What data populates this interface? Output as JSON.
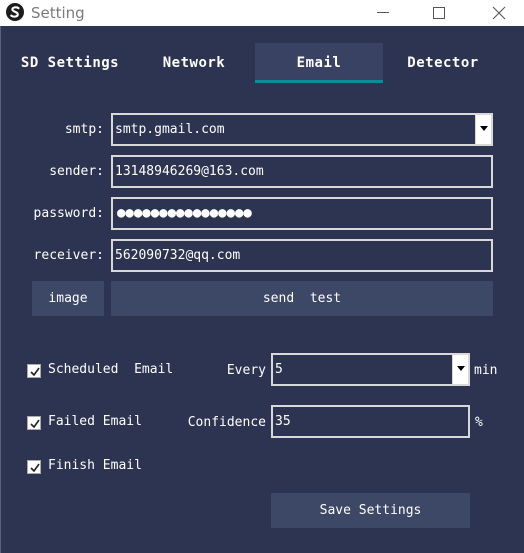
{
  "window": {
    "title": "Setting",
    "app_icon": "s-logo-icon",
    "controls": [
      "minimize-icon",
      "maximize-icon",
      "close-icon"
    ]
  },
  "tabs": [
    {
      "label": "SD Settings",
      "active": false
    },
    {
      "label": "Network",
      "active": false
    },
    {
      "label": "Email",
      "active": true
    },
    {
      "label": "Detector",
      "active": false
    }
  ],
  "email_form": {
    "smtp": {
      "label": "smtp:",
      "value": "smtp.gmail.com"
    },
    "sender": {
      "label": "sender:",
      "value": "13148946269@163.com"
    },
    "password": {
      "label": "password:",
      "value": "●●●●●●●●●●●●●●●●"
    },
    "receiver": {
      "label": "receiver:",
      "value": "562090732@qq.com"
    },
    "image_button": "image",
    "send_test_button": "send  test"
  },
  "options": {
    "scheduled": {
      "label": "Scheduled  Email",
      "checked": true
    },
    "every_label": "Every",
    "every_value": "5",
    "every_unit": "min",
    "failed": {
      "label": "Failed Email",
      "checked": true
    },
    "confidence_label": "Confidence",
    "confidence_value": "35",
    "confidence_unit": "%",
    "finish": {
      "label": "Finish Email",
      "checked": true
    }
  },
  "save_button": "Save Settings",
  "colors": {
    "background": "#2d3451",
    "tab_active": "#3a4263",
    "tab_underline": "#0f8a96",
    "button": "#3d4866",
    "text": "#ffffff"
  }
}
